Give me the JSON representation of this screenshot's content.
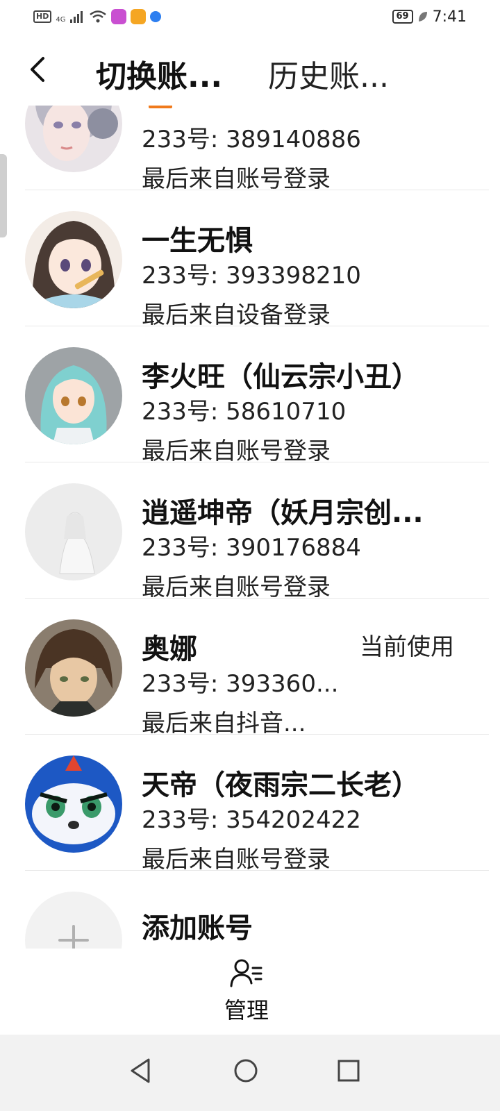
{
  "status_bar": {
    "hd": "HD",
    "network": "4G",
    "battery": "69",
    "time": "7:41"
  },
  "header": {
    "back_icon": "chevron-left-icon",
    "tab_switch": "切换账...",
    "tab_history": "历史账..."
  },
  "accounts": [
    {
      "name": "",
      "uid": "233号: 389140886",
      "login": "最后来自账号登录",
      "current": ""
    },
    {
      "name": "一生无惧",
      "uid": "233号: 393398210",
      "login": "最后来自设备登录",
      "current": ""
    },
    {
      "name": "李火旺（仙云宗小丑）",
      "uid": "233号: 58610710",
      "login": "最后来自账号登录",
      "current": ""
    },
    {
      "name": "逍遥坤帝（妖月宗创...",
      "uid": "233号: 390176884",
      "login": "最后来自账号登录",
      "current": ""
    },
    {
      "name": "奥娜",
      "uid": "233号: 393360...",
      "login": "最后来自抖音...",
      "current": "当前使用"
    },
    {
      "name": "天帝（夜雨宗二长老）",
      "uid": "233号: 354202422",
      "login": "最后来自账号登录",
      "current": ""
    }
  ],
  "add_account": {
    "label": "添加账号",
    "icon": "plus-icon"
  },
  "manage": {
    "label": "管理",
    "icon": "user-list-icon"
  },
  "nav": {
    "back": "triangle-back-icon",
    "home": "circle-home-icon",
    "recents": "square-recents-icon"
  },
  "colors": {
    "accent_orange": "#f07a1c",
    "separator": "#e8e8e8",
    "navbar_bg": "#f2f2f2"
  }
}
